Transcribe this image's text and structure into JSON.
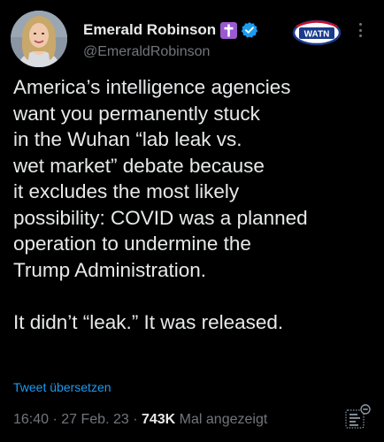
{
  "author": {
    "display_name": "Emerald Robinson",
    "handle": "@EmeraldRobinson",
    "avatar_icon": "profile-photo",
    "badges": [
      "cross-icon",
      "verified-badge-icon"
    ],
    "logo_text": "WATN"
  },
  "tweet": {
    "lines": [
      "America’s intelligence agencies",
      "want you permanently stuck",
      "in the Wuhan “lab leak vs.",
      "wet market” debate because",
      "it excludes the most likely",
      "possibility: COVID was a planned",
      "operation to undermine the",
      "Trump Administration."
    ],
    "paragraph2": "It didn’t “leak.” It was released."
  },
  "translate_label": "Tweet übersetzen",
  "meta": {
    "time": "16:40",
    "separator": " · ",
    "date": "27 Feb. 23",
    "views_count": "743K",
    "views_label": " Mal angezeigt"
  },
  "colors": {
    "background": "#000000",
    "text": "#e7e9ea",
    "secondary": "#71767b",
    "link": "#1d9bf0",
    "verified": "#1d9bf0",
    "badge": "#9b59d0"
  }
}
